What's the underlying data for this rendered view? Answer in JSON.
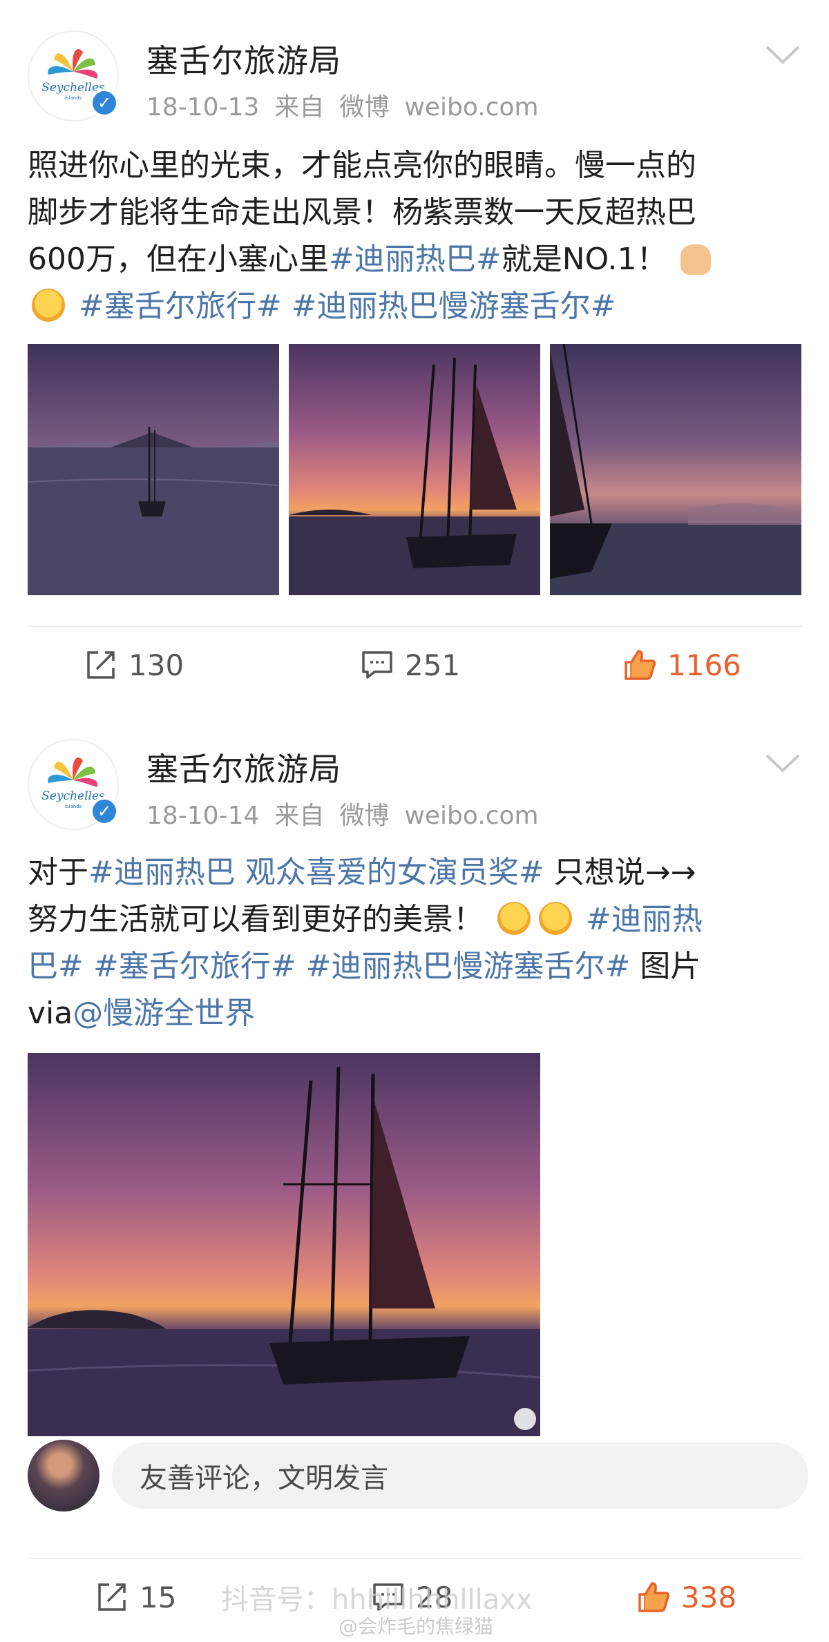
{
  "posts": [
    {
      "author": "塞舌尔旅游局",
      "date": "18-10-13",
      "from_label": "来自",
      "source": "微博",
      "domain": "weibo.com",
      "text": {
        "p1": "照进你心里的光束，才能点亮你的眼睛。慢一点的",
        "p2": "脚步才能将生命走出风景！杨紫票数一天反超热巴",
        "p3a": "600万，但在小塞心里",
        "tag1": "#迪丽热巴#",
        "p3b": "就是NO.1！",
        "tag2": "#塞舌尔旅行#",
        "tag3": "#迪丽热巴慢游塞舌尔#"
      },
      "repost_count": "130",
      "comment_count": "251",
      "like_count": "1166"
    },
    {
      "author": "塞舌尔旅游局",
      "date": "18-10-14",
      "from_label": "来自",
      "source": "微博",
      "domain": "weibo.com",
      "text": {
        "p1a": "对于",
        "tag1": "#迪丽热巴 观众喜爱的女演员奖#",
        "p1b": " 只想说→→",
        "p2a": "努力生活就可以看到更好的美景！",
        "tag2a": "#迪丽热",
        "tag2b": "巴#",
        "tag3": "#塞舌尔旅行#",
        "tag4": "#迪丽热巴慢游塞舌尔#",
        "p3": "图片",
        "p4a": "via",
        "mention": "@慢游全世界"
      },
      "comment_placeholder": "友善评论，文明发言",
      "repost_count": "15",
      "comment_count": "28",
      "like_count": "338"
    }
  ],
  "watermark": {
    "douyin": "抖音号：hhhlllhhhlllaxx",
    "weibo": "@会炸毛的焦绿猫"
  },
  "colors": {
    "link": "#4c76a8",
    "like": "#e8602c",
    "meta": "#9a9a9a"
  },
  "icons": [
    "seychelles-logo-icon",
    "verified-badge-icon",
    "chevron-down-icon",
    "repost-icon",
    "comment-icon",
    "like-icon",
    "emoji-icon"
  ]
}
